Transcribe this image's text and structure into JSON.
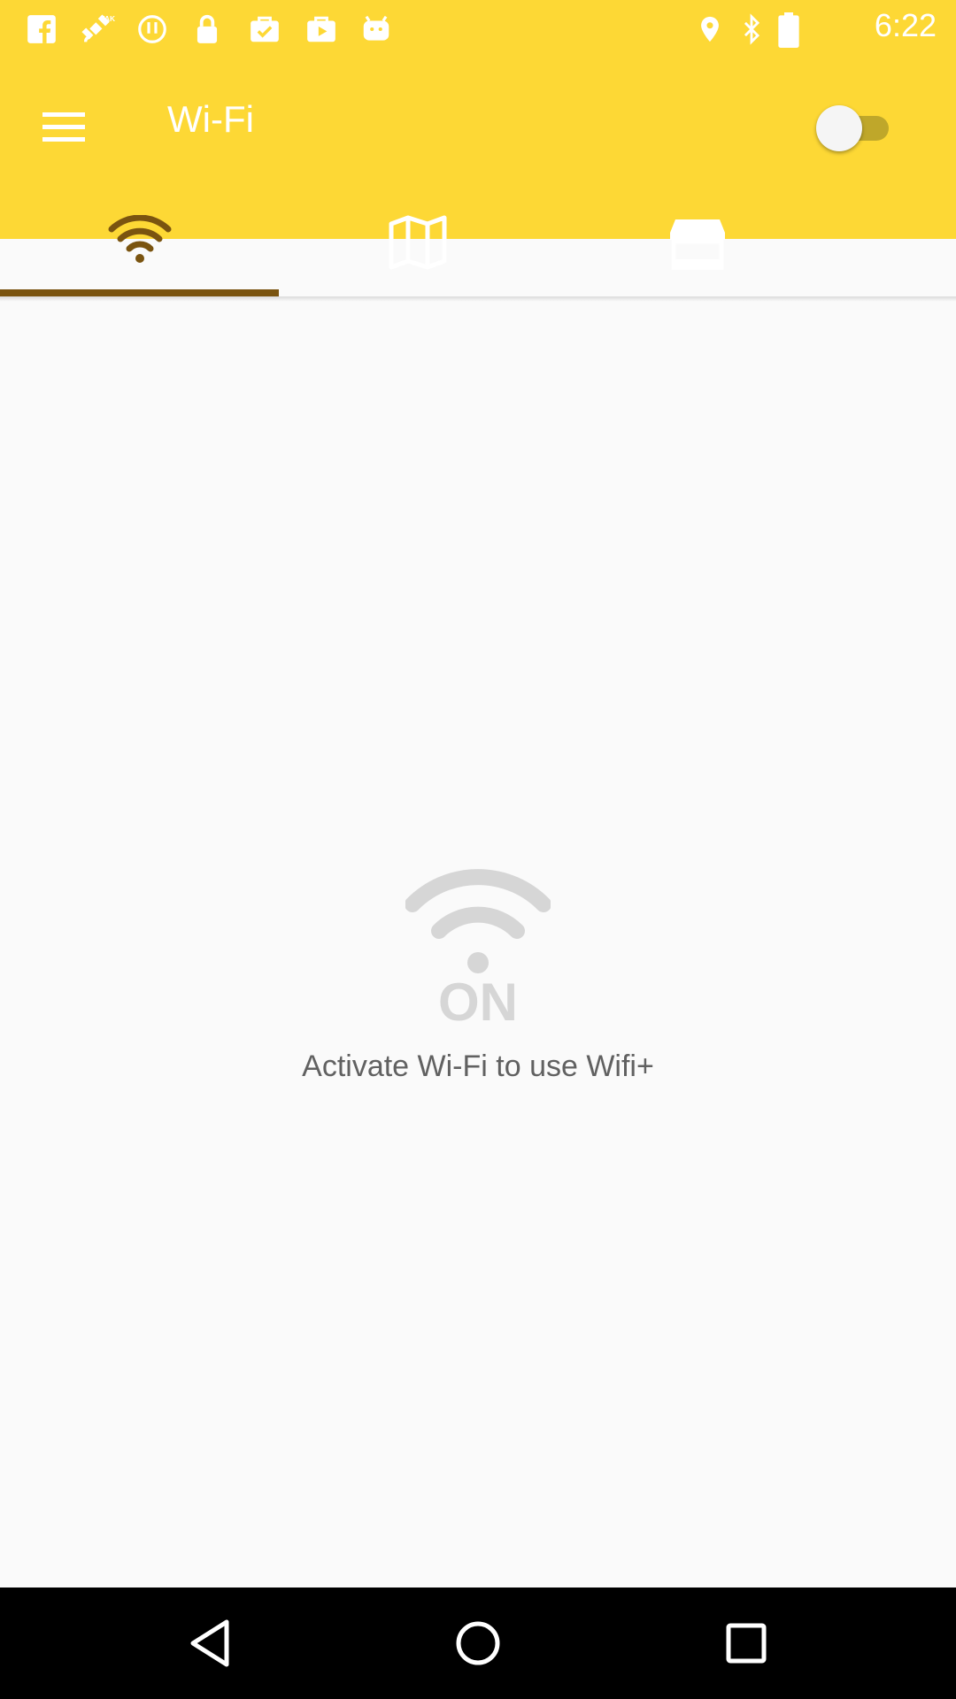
{
  "status_bar": {
    "time": "6:22",
    "left_icons": [
      "facebook-icon",
      "fake-gps-satellite-icon",
      "alert-circle-icon",
      "lock-icon",
      "check-bag-icon",
      "play-store-icon",
      "android-icon"
    ],
    "right_icons": [
      "location-pin-icon",
      "bluetooth-icon",
      "battery-icon"
    ]
  },
  "app_bar": {
    "title": "Wi-Fi",
    "toggle_state": "off",
    "background_color": "#FDD835"
  },
  "tabs": [
    {
      "icon": "wifi-icon",
      "selected": true
    },
    {
      "icon": "map-icon",
      "selected": false
    },
    {
      "icon": "store-icon",
      "selected": false
    }
  ],
  "main": {
    "on_label": "ON",
    "message": "Activate Wi-Fi to use Wifi+"
  },
  "nav_bar": {
    "buttons": [
      "back-icon",
      "home-icon",
      "recents-icon"
    ]
  }
}
